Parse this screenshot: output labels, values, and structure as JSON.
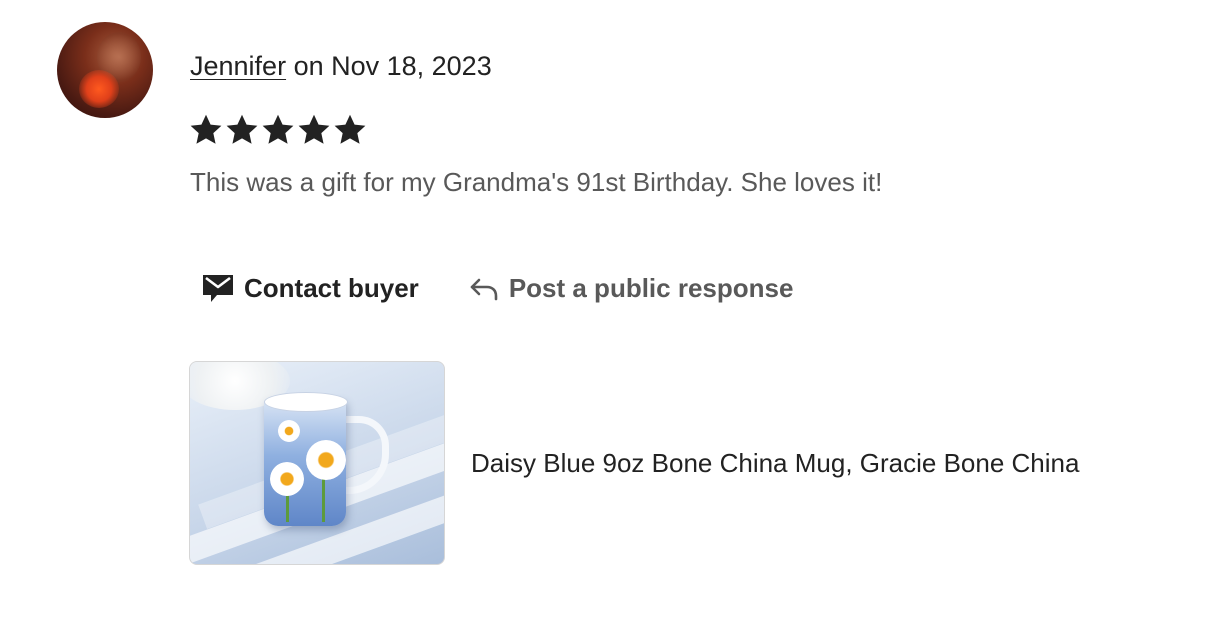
{
  "review": {
    "author": "Jennifer",
    "date_text": " on Nov 18, 2023",
    "rating": 5,
    "rating_max": 5,
    "text": "This was a gift for my Grandma's 91st Birthday. She loves it!"
  },
  "actions": {
    "contact_label": "Contact buyer",
    "respond_label": "Post a public response"
  },
  "product": {
    "title": "Daisy Blue 9oz Bone China Mug, Gracie Bone China"
  },
  "icons": {
    "star": "star-icon",
    "contact": "envelope-icon",
    "respond": "reply-arrow-icon"
  },
  "colors": {
    "text_primary": "#222222",
    "text_secondary": "#595959",
    "star": "#222222"
  }
}
